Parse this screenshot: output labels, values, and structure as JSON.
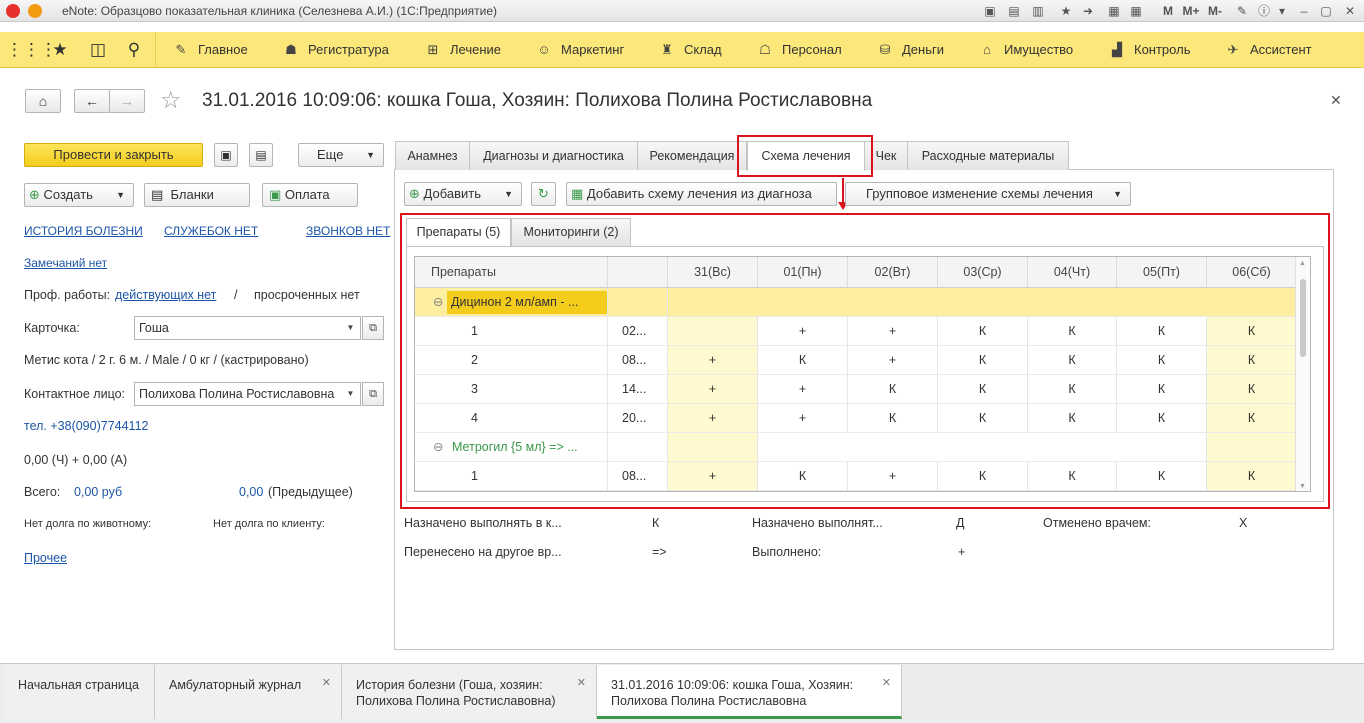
{
  "window": {
    "title": "eNote: Образцово показательная клиника (Селезнева А.И.)  (1С:Предприятие)"
  },
  "menu": {
    "items": [
      {
        "label": "Главное",
        "icon": "pencil-icon"
      },
      {
        "label": "Регистратура",
        "icon": "person-icon"
      },
      {
        "label": "Лечение",
        "icon": "treatment-icon"
      },
      {
        "label": "Маркетинг",
        "icon": "marketing-icon"
      },
      {
        "label": "Склад",
        "icon": "warehouse-icon"
      },
      {
        "label": "Персонал",
        "icon": "staff-icon"
      },
      {
        "label": "Деньги",
        "icon": "money-icon"
      },
      {
        "label": "Имущество",
        "icon": "property-icon"
      },
      {
        "label": "Контроль",
        "icon": "chart-icon"
      },
      {
        "label": "Ассистент",
        "icon": "assistant-icon"
      }
    ]
  },
  "doc": {
    "title": "31.01.2016 10:09:06: кошка Гоша, Хозяин: Полихова Полина Ростиславовна"
  },
  "left": {
    "post_close": "Провести и закрыть",
    "more": "Еще",
    "create": "Создать",
    "blanks": "Бланки",
    "payment": "Оплата",
    "history_link": "ИСТОРИЯ БОЛЕЗНИ",
    "memos_link": "СЛУЖЕБОК НЕТ",
    "calls_link": "ЗВОНКОВ НЕТ",
    "remarks_link": "Замечаний нет",
    "prof_label": "Проф. работы:",
    "prof_active": "действующих нет",
    "prof_sep": "/",
    "prof_overdue": "просроченных нет",
    "card_label": "Карточка:",
    "card_value": "Гоша",
    "pet_info": "Метис кота / 2 г. 6 м. / Male / 0 кг / (кастрировано)",
    "contact_label": "Контактное лицо:",
    "contact_value": "Полихова Полина Ростиславовна",
    "phone": "тел. +38(090)7744112",
    "balance": "0,00 (Ч) + 0,00 (А)",
    "total_label": "Всего:",
    "total_value": "0,00 руб",
    "prev_value": "0,00",
    "prev_label": "(Предыдущее)",
    "no_debt_animal": "Нет долга по животному:",
    "no_debt_client": "Нет долга по клиенту:",
    "other_link": "Прочее"
  },
  "tabs": [
    "Анамнез",
    "Диагнозы и диагностика",
    "Рекомендация",
    "Схема лечения",
    "Чек",
    "Расходные материалы"
  ],
  "scheme": {
    "add": "Добавить",
    "add_from_diag": "Добавить схему лечения из диагноза",
    "group_change": "Групповое изменение схемы лечения",
    "subtabs": [
      "Препараты (5)",
      "Мониторинги (2)"
    ],
    "headers": [
      "Препараты",
      "",
      "31(Вс)",
      "01(Пн)",
      "02(Вт)",
      "03(Ср)",
      "04(Чт)",
      "05(Пт)",
      "06(Сб)"
    ],
    "group1": "Дицинон 2 мл/амп - ...",
    "group2": "Метрогил {5 мл} => ...",
    "rows": [
      {
        "num": "1",
        "time": "02...",
        "days": [
          "",
          "+",
          "+",
          "К",
          "К",
          "К",
          "К"
        ]
      },
      {
        "num": "2",
        "time": "08...",
        "days": [
          "+",
          "К",
          "+",
          "К",
          "К",
          "К",
          "К"
        ]
      },
      {
        "num": "3",
        "time": "14...",
        "days": [
          "+",
          "+",
          "К",
          "К",
          "К",
          "К",
          "К"
        ]
      },
      {
        "num": "4",
        "time": "20...",
        "days": [
          "+",
          "+",
          "К",
          "К",
          "К",
          "К",
          "К"
        ]
      },
      {
        "num": "1",
        "time": "08...",
        "days": [
          "+",
          "К",
          "+",
          "К",
          "К",
          "К",
          "К"
        ]
      }
    ],
    "legend": [
      {
        "label": "Назначено выполнять в к...",
        "sym": "К"
      },
      {
        "label": "Назначено выполнят...",
        "sym": "Д"
      },
      {
        "label": "Отменено врачем:",
        "sym": "Х"
      },
      {
        "label": "Перенесено на другое вр...",
        "sym": "=>"
      },
      {
        "label": "Выполнено:",
        "sym": "+"
      }
    ]
  },
  "taskbar": [
    {
      "label": "Начальная страница"
    },
    {
      "label": "Амбулаторный журнал"
    },
    {
      "label": "История болезни (Гоша, хозяин: Полихова Полина Ростиславовна)"
    },
    {
      "label": "31.01.2016 10:09:06: кошка Гоша, Хозяин: Полихова Полина Ростиславовна"
    }
  ],
  "colors": {
    "menubar": "#fbe77a",
    "accent_yellow": "#f4cc1c",
    "highlight_red": "#d9141c",
    "active_tab_green": "#3a9a4a"
  }
}
